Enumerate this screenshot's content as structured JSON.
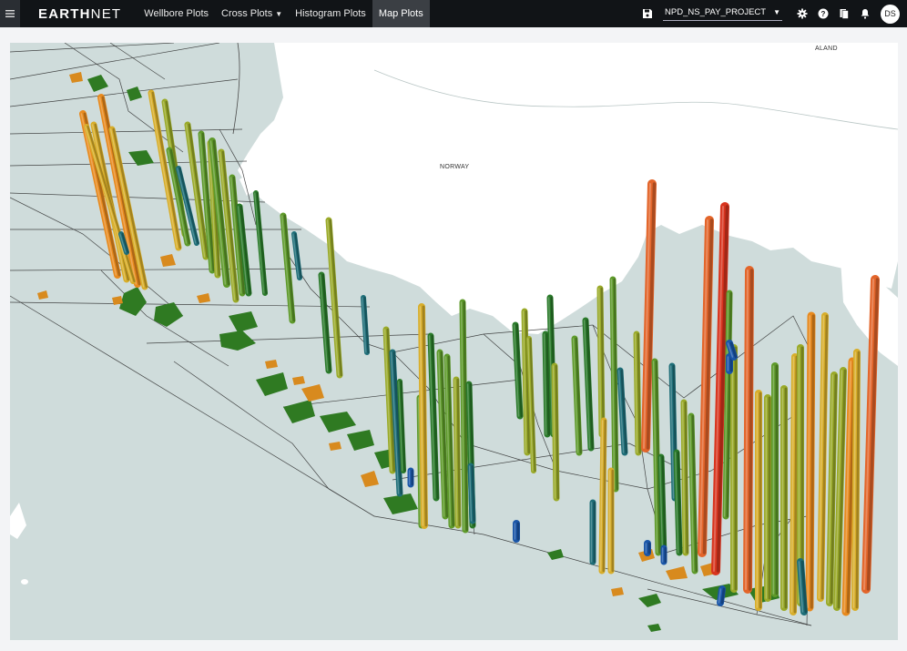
{
  "app": {
    "brand_bold": "EARTH",
    "brand_light": "NET"
  },
  "nav": {
    "tabs": [
      {
        "label": "Wellbore Plots",
        "has_caret": false,
        "active": false
      },
      {
        "label": "Cross Plots",
        "has_caret": true,
        "active": false
      },
      {
        "label": "Histogram Plots",
        "has_caret": false,
        "active": false
      },
      {
        "label": "Map Plots",
        "has_caret": false,
        "active": true
      }
    ]
  },
  "toolbar": {
    "project_selected": "NPD_NS_PAY_PROJECT",
    "user_initials": "DS",
    "icons": [
      "save-icon",
      "settings-icon",
      "help-icon",
      "book-icon",
      "bell-icon"
    ]
  },
  "map": {
    "labels": {
      "country_main": "NORWAY",
      "country_corner": "ALAND"
    },
    "colors": {
      "land": "#ffffff",
      "sea": "#cfdcdb",
      "green_fields": "#2f7a22",
      "orange_fields": "#d88a1e",
      "grid_lines": "#2a2a2a"
    },
    "well_colors": [
      "#1a56a8",
      "#1e6e78",
      "#2a7a2a",
      "#5e9a2a",
      "#9aaa28",
      "#d8ae2a",
      "#e88a1e",
      "#e3652a",
      "#d8341e"
    ]
  }
}
